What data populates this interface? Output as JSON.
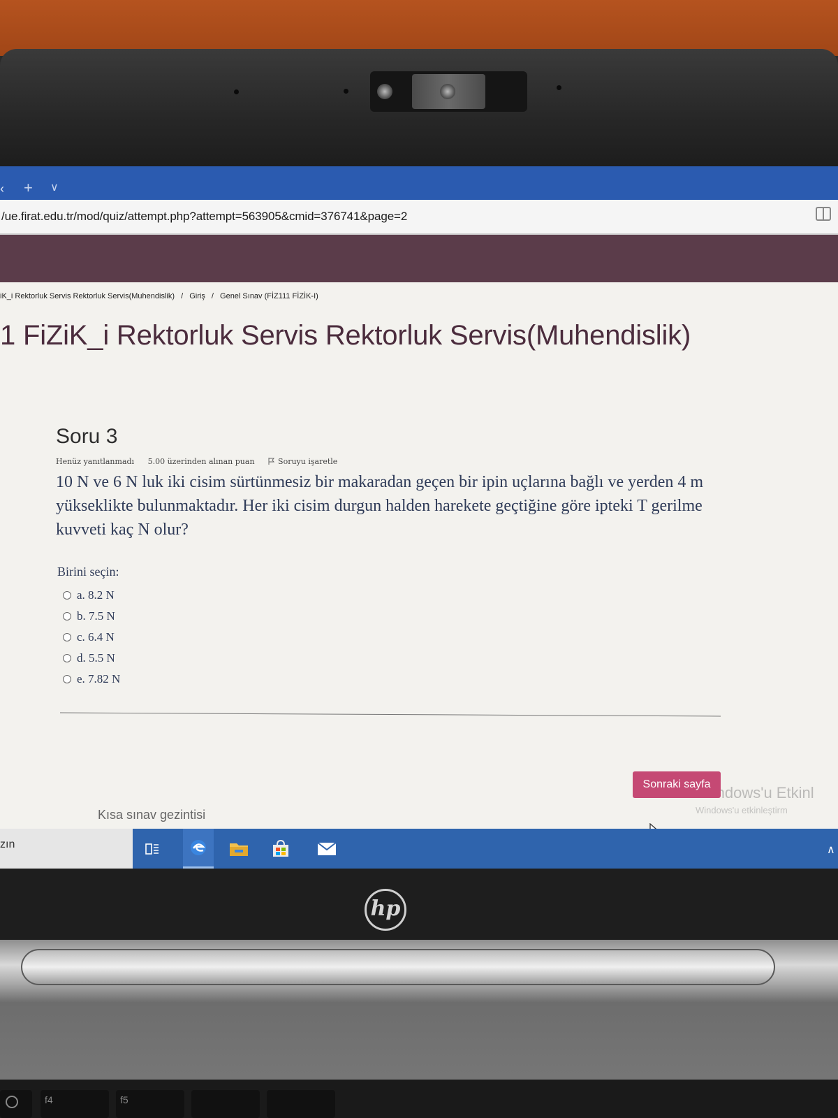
{
  "browser": {
    "url": "/ue.firat.edu.tr/mod/quiz/attempt.php?attempt=563905&cmid=376741&page=2"
  },
  "breadcrumb": [
    "iK_i Rektorluk Servis Rektorluk Servis(Muhendislik)",
    "/",
    "Giriş",
    "/",
    "Genel Sınav (FİZ111 FİZİK-I)"
  ],
  "page": {
    "course_title": "1 FiZiK_i Rektorluk Servis Rektorluk Servis(Muhendislik)"
  },
  "question": {
    "number_label": "Soru 3",
    "status": "Henüz yanıtlanmadı",
    "grade": "5.00 üzerinden alınan puan",
    "flag_label": "Soruyu işaretle",
    "text": "10 N ve 6 N luk iki cisim sürtünmesiz bir makaradan geçen bir ipin uçlarına bağlı ve yerden 4 m yükseklikte bulunmaktadır. Her iki cisim durgun halden harekete geçtiğine göre ipteki T gerilme kuvveti kaç N olur?",
    "choose_label": "Birini seçin:",
    "options": [
      {
        "label": "a. 8.2 N"
      },
      {
        "label": "b. 7.5 N"
      },
      {
        "label": "c. 6.4 N"
      },
      {
        "label": "d. 5.5 N"
      },
      {
        "label": "e. 7.82 N"
      }
    ]
  },
  "actions": {
    "next_page": "Sonraki sayfa"
  },
  "quiz_nav": {
    "title": "Kısa sınav gezintisi"
  },
  "watermark": {
    "line1": "Windows'u Etkinl",
    "line2": "Windows'u etkinleştirm"
  },
  "taskbar": {
    "search_text": "zın",
    "icons": [
      "task-view-icon",
      "edge-icon",
      "file-explorer-icon",
      "store-icon",
      "mail-icon"
    ]
  },
  "keyboard": {
    "keys": [
      "f4",
      "f5"
    ]
  },
  "colors": {
    "header": "#5b3c4a",
    "title": "#4b2c3d",
    "button": "#c54974",
    "taskbar": "#2f64ad",
    "tabbar": "#2b5bb0"
  }
}
